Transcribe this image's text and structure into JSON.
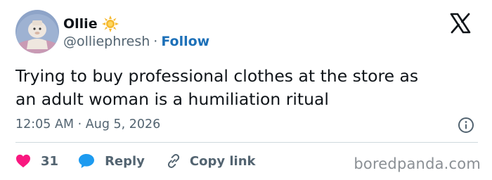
{
  "user": {
    "display_name": "Ollie",
    "handle": "@olliephresh",
    "separator": "·",
    "follow_label": "Follow"
  },
  "tweet": {
    "text": "Trying to buy professional clothes at the store as\nan adult woman is a humiliation ritual",
    "timestamp": "12:05 AM · Aug 5, 2026"
  },
  "actions": {
    "like_count": "31",
    "reply_label": "Reply",
    "copy_link_label": "Copy link"
  },
  "watermark": "boredpanda.com",
  "icons": {
    "verified": "sun-badge-icon",
    "platform": "x-logo-icon",
    "info": "info-icon",
    "like": "heart-icon",
    "reply": "speech-bubble-icon",
    "copy": "link-icon"
  },
  "colors": {
    "follow": "#1d70b8",
    "heart": "#f91880",
    "reply_bubble": "#1d9bf0",
    "secondary_text": "#536471",
    "badge": "#f5b82e"
  }
}
